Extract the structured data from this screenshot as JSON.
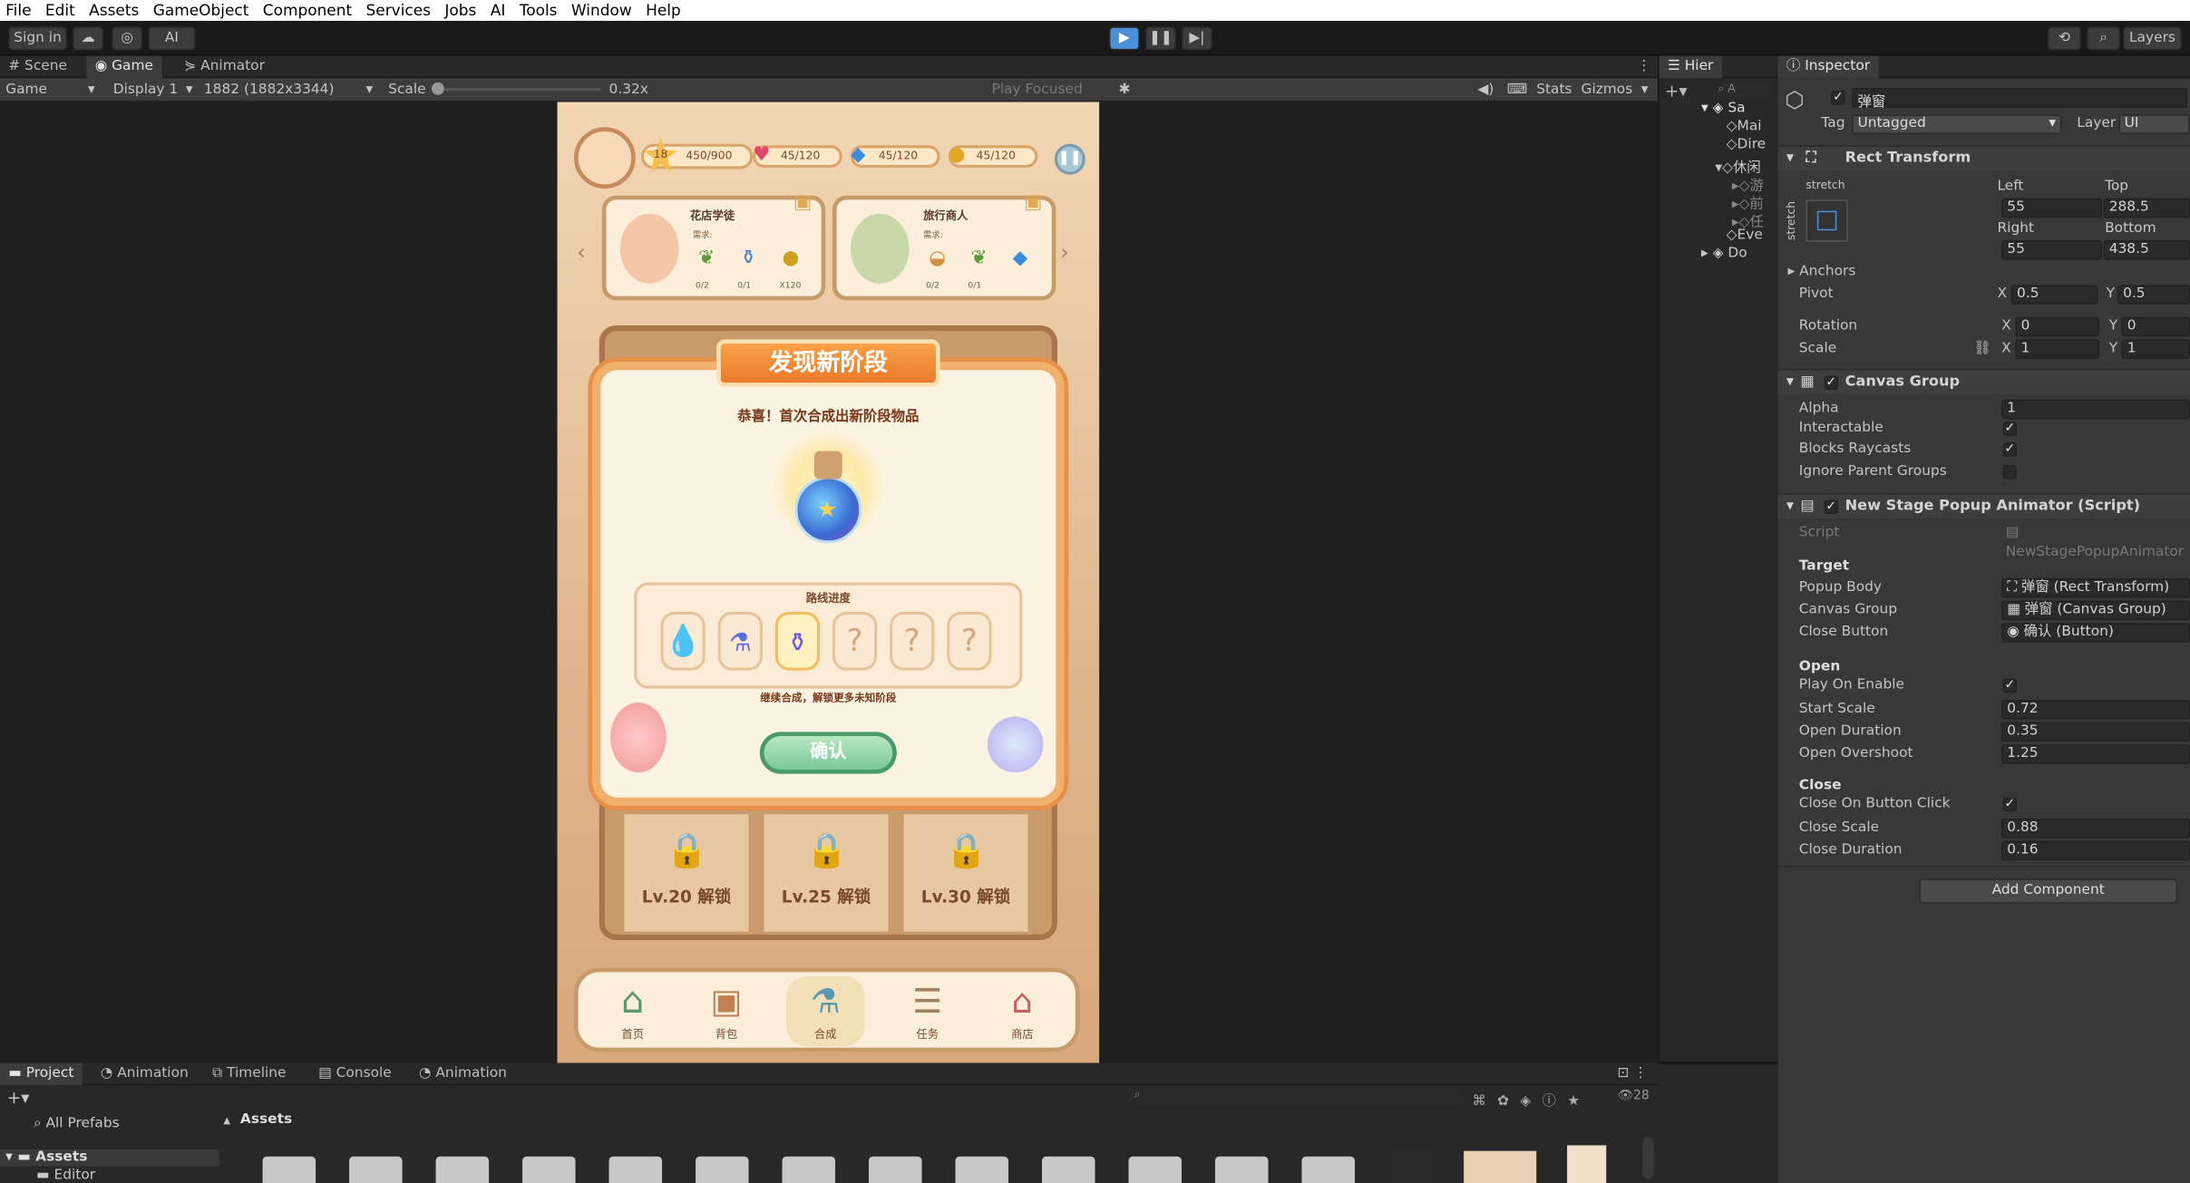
{
  "menu": [
    "File",
    "Edit",
    "Assets",
    "GameObject",
    "Component",
    "Services",
    "Jobs",
    "AI",
    "Tools",
    "Window",
    "Help"
  ],
  "toolbar": {
    "sign_in": "Sign in",
    "ai": "AI",
    "layers": "Layers"
  },
  "tabs": {
    "scene": "Scene",
    "game": "Game",
    "animator": "Animator"
  },
  "gametool": {
    "mode": "Game",
    "display": "Display 1",
    "resolution": "1882 (1882x3344)",
    "scale_label": "Scale",
    "scale_value": "0.32x",
    "play_focused": "Play Focused",
    "stats": "Stats",
    "gizmos": "Gizmos"
  },
  "hierarchy": {
    "tab": "Hier",
    "items": [
      "Sa",
      "Mai",
      "Dire",
      "休闲",
      "游",
      "前",
      "任",
      "Eve",
      "Do"
    ]
  },
  "inspector": {
    "tab": "Inspector",
    "object_name": "弹窗",
    "tag_label": "Tag",
    "tag_value": "Untagged",
    "layer_label": "Layer",
    "layer_value": "UI",
    "rect": {
      "title": "Rect Transform",
      "stretch": "stretch",
      "left_label": "Left",
      "left": "55",
      "top_label": "Top",
      "top": "288.5",
      "right_label": "Right",
      "right": "55",
      "bottom_label": "Bottom",
      "bottom": "438.5",
      "anchors": "Anchors",
      "pivot": "Pivot",
      "pivot_x": "0.5",
      "pivot_y": "0.5",
      "rotation": "Rotation",
      "rot_x": "0",
      "rot_y": "0",
      "scale": "Scale",
      "scale_x": "1",
      "scale_y": "1",
      "x": "X",
      "y": "Y"
    },
    "canvas_group": {
      "title": "Canvas Group",
      "alpha_label": "Alpha",
      "alpha": "1",
      "interactable": "Interactable",
      "blocks": "Blocks Raycasts",
      "ignore": "Ignore Parent Groups"
    },
    "script": {
      "title": "New Stage Popup Animator (Script)",
      "script_label": "Script",
      "script_value": "NewStagePopupAnimator",
      "target": "Target",
      "popup_body": "Popup Body",
      "popup_body_val": "弹窗 (Rect Transform)",
      "canvas_group": "Canvas Group",
      "canvas_group_val": "弹窗 (Canvas Group)",
      "close_button": "Close Button",
      "close_button_val": "确认 (Button)",
      "open": "Open",
      "play_on_enable": "Play On Enable",
      "start_scale": "Start Scale",
      "start_scale_val": "0.72",
      "open_duration": "Open Duration",
      "open_duration_val": "0.35",
      "open_overshoot": "Open Overshoot",
      "open_overshoot_val": "1.25",
      "close": "Close",
      "close_on_click": "Close On Button Click",
      "close_scale": "Close Scale",
      "close_scale_val": "0.88",
      "close_duration": "Close Duration",
      "close_duration_val": "0.16"
    },
    "add_component": "Add Component"
  },
  "bottom": {
    "tabs": [
      "Project",
      "Animation",
      "Timeline",
      "Console",
      "Animation"
    ],
    "all_prefabs": "All Prefabs",
    "assets_header": "Assets",
    "assets_tree": "Assets",
    "editor": "Editor",
    "count": "28"
  },
  "game": {
    "level": "18",
    "exp": "450/900",
    "hearts": "45/120",
    "gems": "45/120",
    "coins": "45/120",
    "card1": {
      "title": "花店学徒",
      "need": "需求:",
      "q1": "0/2",
      "q2": "0/1",
      "q3": "X120"
    },
    "card2": {
      "title": "旅行商人",
      "need": "需求:",
      "q1": "0/2",
      "q2": "0/1"
    },
    "popup": {
      "title": "发现新阶段",
      "subtitle": "恭喜！首次合成出新阶段物品",
      "progress_title": "路线进度",
      "hint": "继续合成，解锁更多未知阶段",
      "confirm": "确认",
      "unknown": "?"
    },
    "locks": [
      "Lv.20 解锁",
      "Lv.25 解锁",
      "Lv.30 解锁"
    ],
    "nav": [
      "首页",
      "背包",
      "合成",
      "任务",
      "商店"
    ]
  },
  "colors": {
    "accent": "#f0b26a",
    "play_active": "#4a90d9",
    "popup_border": "#e8904a"
  }
}
